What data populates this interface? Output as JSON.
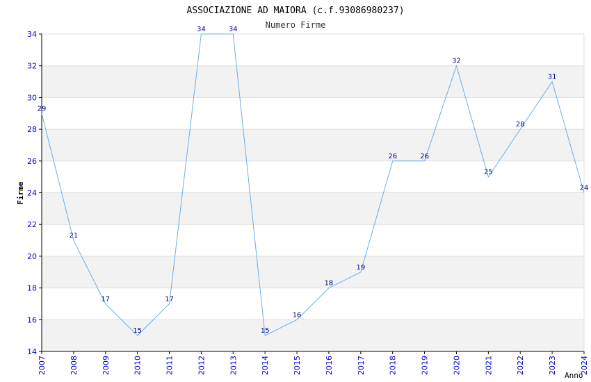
{
  "chart_data": {
    "type": "line",
    "title": "ASSOCIAZIONE AD MAIORA (c.f.93086980237)",
    "subtitle": "Numero Firme",
    "xlabel": "Anno",
    "ylabel": "Firme",
    "ylim": [
      14,
      34
    ],
    "yticks": [
      14,
      16,
      18,
      20,
      22,
      24,
      26,
      28,
      30,
      32,
      34
    ],
    "grid": true,
    "x": [
      "2007",
      "2008",
      "2009",
      "2010",
      "2011",
      "2012",
      "2013",
      "2014",
      "2015",
      "2016",
      "2017",
      "2018",
      "2019",
      "2020",
      "2021",
      "2022",
      "2023",
      "2024"
    ],
    "series": [
      {
        "values": [
          29,
          21,
          17,
          15,
          17,
          34,
          34,
          15,
          16,
          18,
          19,
          26,
          26,
          32,
          25,
          28,
          31,
          24
        ]
      }
    ],
    "colors": {
      "line": "#6aaee8",
      "label": "#00008b",
      "tick": "#0000cc",
      "band": "#f2f2f2",
      "grid": "#dddddd",
      "axis": "#000000"
    }
  }
}
